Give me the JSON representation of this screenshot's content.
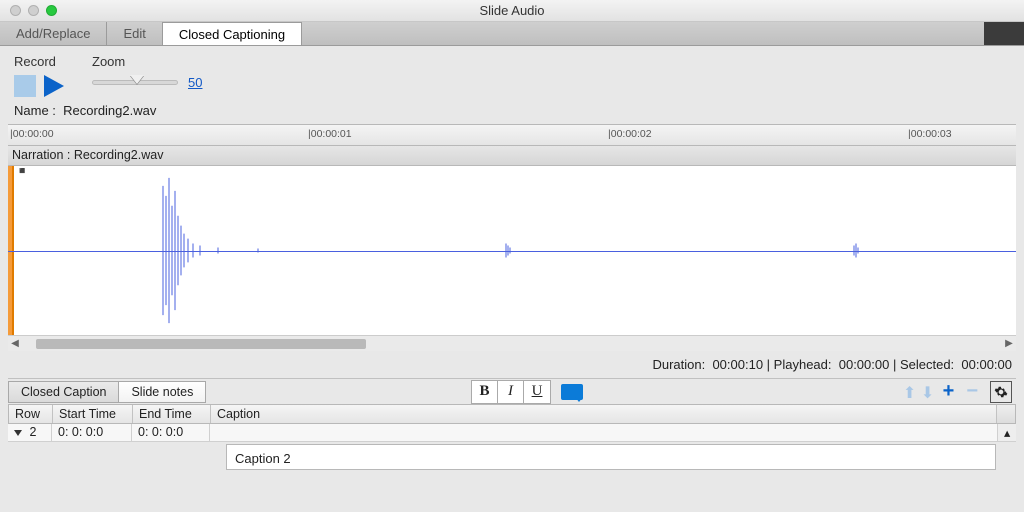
{
  "window": {
    "title": "Slide Audio"
  },
  "tabs": {
    "items": [
      {
        "label": "Add/Replace",
        "active": false
      },
      {
        "label": "Edit",
        "active": false
      },
      {
        "label": "Closed Captioning",
        "active": true
      }
    ]
  },
  "toolbar": {
    "record_label": "Record",
    "zoom_label": "Zoom",
    "zoom_value": "50"
  },
  "audio": {
    "name_label": "Name :",
    "name_value": "Recording2.wav",
    "narration_label": "Narration : Recording2.wav"
  },
  "ruler": {
    "ticks": [
      "|00:00:00",
      "|00:00:01",
      "|00:00:02",
      "|00:00:03"
    ]
  },
  "status": {
    "duration_label": "Duration:",
    "duration_value": "00:00:10",
    "playhead_label": "Playhead:",
    "playhead_value": "00:00:00",
    "selected_label": "Selected:",
    "selected_value": "00:00:00"
  },
  "cc": {
    "subtabs": {
      "caption": "Closed Caption",
      "notes": "Slide notes"
    },
    "columns": {
      "row": "Row",
      "start": "Start Time",
      "end": "End Time",
      "caption": "Caption"
    },
    "rows": [
      {
        "row": "2",
        "start": "0: 0: 0:0",
        "end": "0: 0: 0:0"
      }
    ],
    "editor_value": "Caption 2"
  },
  "icons": {
    "bold": "B",
    "italic": "I",
    "underline": "U"
  }
}
